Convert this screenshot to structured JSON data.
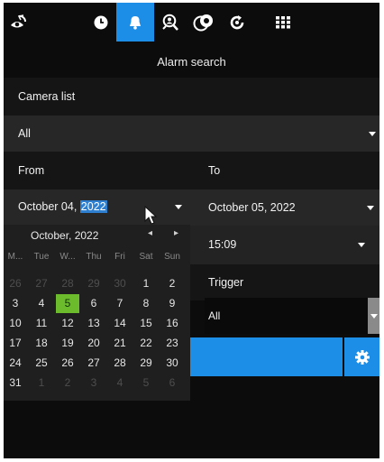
{
  "toolbar": {
    "items": [
      {
        "icon": "eye-refresh-icon",
        "active": false
      },
      {
        "icon": "clock-icon",
        "active": false
      },
      {
        "icon": "bell-icon",
        "active": true
      },
      {
        "icon": "person-search-icon",
        "active": false
      },
      {
        "icon": "overlap-circles-icon",
        "active": false
      },
      {
        "icon": "settings-refresh-icon",
        "active": false
      },
      {
        "icon": "grid-icon",
        "active": false
      }
    ]
  },
  "heading": "Alarm search",
  "camera": {
    "label": "Camera list",
    "value": "All"
  },
  "from": {
    "label": "From",
    "date_prefix": "October 04, ",
    "date_year": "2022"
  },
  "to": {
    "label": "To",
    "date": "October 05, 2022",
    "time": "15:09"
  },
  "trigger": {
    "label": "Trigger",
    "value": "All"
  },
  "calendar": {
    "title": "October, 2022",
    "prev": "◂",
    "next": "▸",
    "weekdays": [
      "M...",
      "Tue",
      "W...",
      "Thu",
      "Fri",
      "Sat",
      "Sun"
    ],
    "weeks": [
      [
        "26",
        "27",
        "28",
        "29",
        "30",
        "1",
        "2"
      ],
      [
        "3",
        "4",
        "5",
        "6",
        "7",
        "8",
        "9"
      ],
      [
        "10",
        "11",
        "12",
        "13",
        "14",
        "15",
        "16"
      ],
      [
        "17",
        "18",
        "19",
        "20",
        "21",
        "22",
        "23"
      ],
      [
        "24",
        "25",
        "26",
        "27",
        "28",
        "29",
        "30"
      ],
      [
        "31",
        "1",
        "2",
        "3",
        "4",
        "5",
        "6"
      ]
    ],
    "selected_day": "5"
  },
  "colors": {
    "accent": "#1d8ee8",
    "selected_day": "#6cbb2d",
    "background": "#0c0c0c"
  }
}
